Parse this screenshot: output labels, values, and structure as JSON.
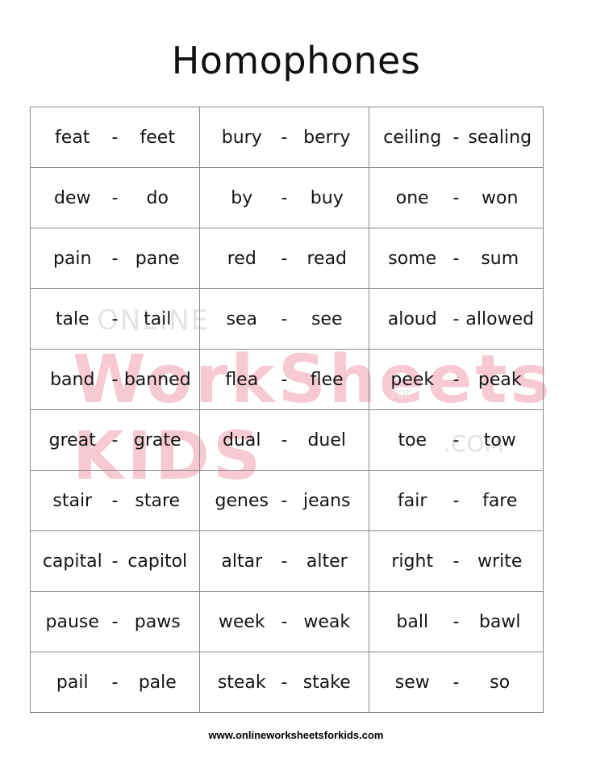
{
  "title": "Homophones",
  "watermark": {
    "line1": "ONLINE",
    "line2": "WorkSheets KIDS",
    "for": "for",
    "com": ".COM",
    "color": "#f6c9d3"
  },
  "separator": "-",
  "rows": [
    [
      [
        "feat",
        "feet"
      ],
      [
        "bury",
        "berry"
      ],
      [
        "ceiling",
        "sealing"
      ]
    ],
    [
      [
        "dew",
        "do"
      ],
      [
        "by",
        "buy"
      ],
      [
        "one",
        "won"
      ]
    ],
    [
      [
        "pain",
        "pane"
      ],
      [
        "red",
        "read"
      ],
      [
        "some",
        "sum"
      ]
    ],
    [
      [
        "tale",
        "tail"
      ],
      [
        "sea",
        "see"
      ],
      [
        "aloud",
        "allowed"
      ]
    ],
    [
      [
        "band",
        "banned"
      ],
      [
        "flea",
        "flee"
      ],
      [
        "peek",
        "peak"
      ]
    ],
    [
      [
        "great",
        "grate"
      ],
      [
        "dual",
        "duel"
      ],
      [
        "toe",
        "tow"
      ]
    ],
    [
      [
        "stair",
        "stare"
      ],
      [
        "genes",
        "jeans"
      ],
      [
        "fair",
        "fare"
      ]
    ],
    [
      [
        "capital",
        "capitol"
      ],
      [
        "altar",
        "alter"
      ],
      [
        "right",
        "write"
      ]
    ],
    [
      [
        "pause",
        "paws"
      ],
      [
        "week",
        "weak"
      ],
      [
        "ball",
        "bawl"
      ]
    ],
    [
      [
        "pail",
        "pale"
      ],
      [
        "steak",
        "stake"
      ],
      [
        "sew",
        "so"
      ]
    ]
  ],
  "footer": "www.onlineworksheetsforkids.com"
}
